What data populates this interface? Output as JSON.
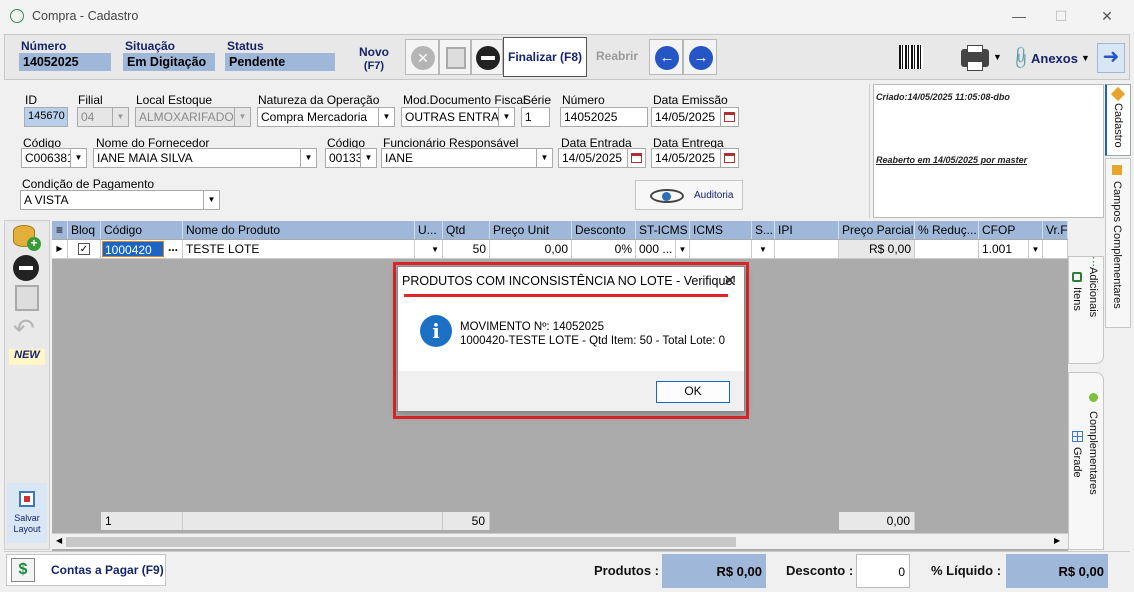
{
  "window": {
    "title": "Compra - Cadastro"
  },
  "header": {
    "numero_label": "Número",
    "numero_value": "14052025",
    "situacao_label": "Situação",
    "situacao_value": "Em Digitação",
    "status_label": "Status",
    "status_value": "Pendente"
  },
  "toolbar": {
    "novo_label": "Novo",
    "novo_shortcut": "(F7)",
    "finalizar_label": "Finalizar (F8)",
    "reabrir_label": "Reabrir",
    "anexos_label": "Anexos"
  },
  "form": {
    "id_label": "ID",
    "id_value": "145670",
    "filial_label": "Filial",
    "filial_value": "04",
    "local_label": "Local Estoque",
    "local_value": "ALMOXARIFADO",
    "natureza_label": "Natureza da Operação",
    "natureza_value": "Compra Mercadoria",
    "moddoc_label": "Mod.Documento Fiscal",
    "moddoc_value": "OUTRAS ENTRAD.",
    "serie_label": "Série",
    "serie_value": "1",
    "numero_label": "Número",
    "numero_value": "14052025",
    "data_emissao_label": "Data Emissão",
    "data_emissao_value": "14/05/2025",
    "codigo_label": "Código",
    "codigo_value": "C006381",
    "fornecedor_label": "Nome do Fornecedor",
    "fornecedor_value": "IANE MAIA SILVA",
    "codigo2_label": "Código",
    "codigo2_value": "00133",
    "funcionario_label": "Funcionário Responsável",
    "funcionario_value": "IANE",
    "data_entrada_label": "Data Entrada",
    "data_entrada_value": "14/05/2025",
    "data_entrega_label": "Data Entrega",
    "data_entrega_value": "14/05/2025",
    "condicao_label": "Condição de Pagamento",
    "condicao_value": "A VISTA",
    "auditoria_label": "Auditoria"
  },
  "info_panel": {
    "criado": "Criado:14/05/2025 11:05:08-dbo",
    "reaberto": "Reaberto em 14/05/2025 por master"
  },
  "side_tabs": {
    "cadastro": "Cadastro",
    "campos_complementares": "Campos Complementares",
    "itens": "Itens",
    "adicionais": "Adicionais",
    "grade": "Grade",
    "complementares": "Complementares"
  },
  "left_actions": {
    "new_label": "NEW",
    "salvar_layout": "Salvar Layout"
  },
  "grid": {
    "headers": [
      "Bloq",
      "Código",
      "Nome do Produto",
      "U...",
      "Qtd",
      "Preço Unit",
      "Desconto",
      "ST-ICMS",
      "ICMS",
      "S...",
      "IPI",
      "Preço Parcial",
      "% Reduç...",
      "CFOP",
      "Vr.F"
    ],
    "row": {
      "codigo": "1000420",
      "ellipsis": "...",
      "nome": "TESTE LOTE",
      "qtd": "50",
      "preco_unit": "0,00",
      "desconto": "0%",
      "st_icms": "000 ...",
      "preco_parcial": "R$ 0,00",
      "cfop": "1.001"
    },
    "footer": {
      "count": "1",
      "qtd_total": "50",
      "parcial_total": "0,00"
    }
  },
  "bottom": {
    "contas_label": "Contas a Pagar (F9)",
    "produtos_label": "Produtos :",
    "produtos_value": "R$ 0,00",
    "desconto_label": "Desconto :",
    "desconto_value": "0",
    "liquido_label": "% Líquido :",
    "liquido_value": "R$ 0,00"
  },
  "dialog": {
    "title": "PRODUTOS COM INCONSISTÊNCIA NO LOTE - Verifique!",
    "line1": "MOVIMENTO Nº: 14052025",
    "line2": "1000420-TESTE LOTE - Qtd Item: 50 - Total Lote: 0",
    "ok_label": "OK",
    "info_glyph": "i"
  },
  "colors": {
    "header_blue": "#9fb8d9",
    "highlight_red": "#e0252b",
    "dialog_accent": "#1a66c2"
  }
}
